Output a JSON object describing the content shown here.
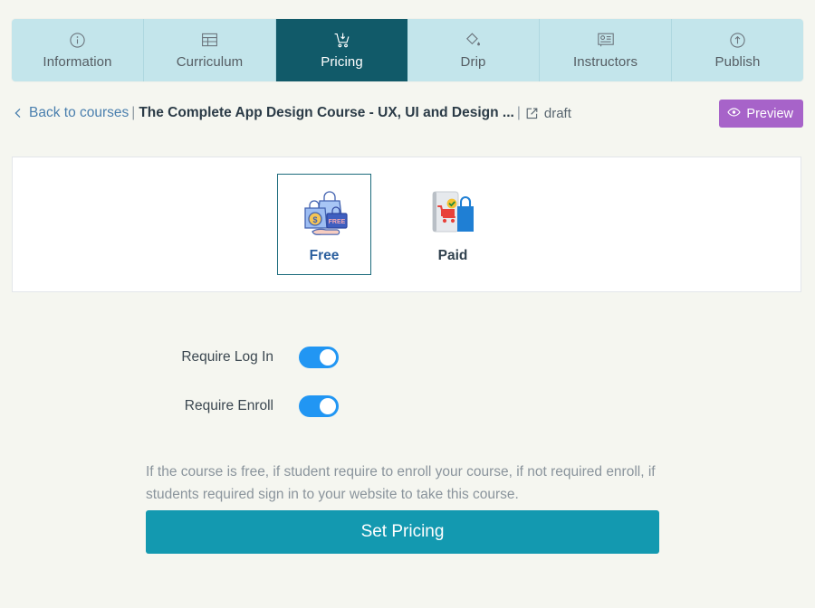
{
  "tabs": [
    {
      "label": "Information",
      "icon": "info-circle-icon",
      "active": false
    },
    {
      "label": "Curriculum",
      "icon": "table-grid-icon",
      "active": false
    },
    {
      "label": "Pricing",
      "icon": "shopping-cart-download-icon",
      "active": true
    },
    {
      "label": "Drip",
      "icon": "paint-drop-icon",
      "active": false
    },
    {
      "label": "Instructors",
      "icon": "id-badge-icon",
      "active": false
    },
    {
      "label": "Publish",
      "icon": "upload-circle-icon",
      "active": false
    }
  ],
  "breadcrumb": {
    "back_label": "Back to courses",
    "separator": "|",
    "course_title": "The Complete App Design Course - UX, UI and Design ...",
    "second_separator": "|",
    "edit_icon": "edit-pencil-square-icon",
    "status": "draft"
  },
  "preview": {
    "label": "Preview",
    "icon": "eye-icon",
    "color": "#a763c9"
  },
  "pricing_types": [
    {
      "label": "Free",
      "icon": "free-shopping-bags-icon",
      "selected": true
    },
    {
      "label": "Paid",
      "icon": "paid-cart-bag-icon",
      "selected": false
    }
  ],
  "options": [
    {
      "label": "Require Log In",
      "state": "on"
    },
    {
      "label": "Require Enroll",
      "state": "on"
    }
  ],
  "help_text": "If the course is free, if student require to enroll your course, if not required enroll, if students required sign in to your website to take this course.",
  "submit": {
    "label": "Set Pricing",
    "color": "#1399b0"
  },
  "theme": {
    "page_background": "#f5f6f0",
    "tab_inactive": "#c3e5eb",
    "tab_active": "#115a69",
    "selected_border": "#1c6b7c",
    "toggle_on": "#2196f3"
  }
}
